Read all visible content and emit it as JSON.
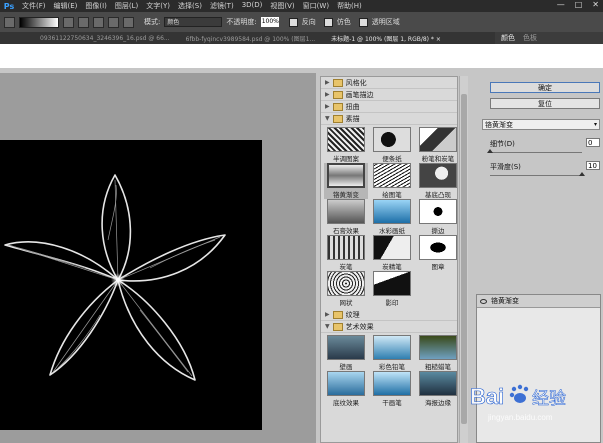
{
  "app": {
    "logo": "Ps"
  },
  "menu": [
    "文件(F)",
    "编辑(E)",
    "图像(I)",
    "图层(L)",
    "文字(Y)",
    "选择(S)",
    "滤镜(T)",
    "3D(D)",
    "视图(V)",
    "窗口(W)",
    "帮助(H)"
  ],
  "window_controls": [
    "—",
    "□",
    "✕"
  ],
  "options": {
    "mode_label": "模式:",
    "mode_value": "颜色",
    "opacity_label": "不透明度:",
    "opacity_value": "100%",
    "reverse_label": "反向",
    "dither_label": "仿色",
    "transparency_label": "透明区域"
  },
  "doc_tabs": [
    "09361122750634_3246396_16.psd @ 66...",
    "6fbb-fyqincv3989584.psd @ 100% (图层1...",
    "未标题-1 @ 100% (图层 1, RGB/8) * ×"
  ],
  "right_tabs": [
    "颜色",
    "色板"
  ],
  "filter_gallery": {
    "categories_top": [
      {
        "label": "风格化",
        "expanded": false
      },
      {
        "label": "画笔描边",
        "expanded": false
      },
      {
        "label": "扭曲",
        "expanded": false
      },
      {
        "label": "素描",
        "expanded": true
      }
    ],
    "sketch_filters": [
      {
        "label": "半调图案",
        "selected": false
      },
      {
        "label": "便条纸",
        "selected": false
      },
      {
        "label": "粉笔和炭笔",
        "selected": false
      },
      {
        "label": "铬黄渐变",
        "selected": true
      },
      {
        "label": "绘图笔",
        "selected": false
      },
      {
        "label": "基底凸现",
        "selected": false
      },
      {
        "label": "石膏效果",
        "selected": false
      },
      {
        "label": "水彩画纸",
        "selected": false
      },
      {
        "label": "撕边",
        "selected": false
      },
      {
        "label": "炭笔",
        "selected": false
      },
      {
        "label": "炭精笔",
        "selected": false
      },
      {
        "label": "图章",
        "selected": false
      },
      {
        "label": "网状",
        "selected": false
      },
      {
        "label": "影印",
        "selected": false
      }
    ],
    "categories_bottom": [
      {
        "label": "纹理",
        "expanded": false
      },
      {
        "label": "艺术效果",
        "expanded": true
      }
    ],
    "art_filters": [
      {
        "label": "壁画"
      },
      {
        "label": "彩色铅笔"
      },
      {
        "label": "粗糙蜡笔"
      },
      {
        "label": "底纹效果"
      },
      {
        "label": "干画笔"
      },
      {
        "label": "海报边缘"
      }
    ]
  },
  "controls": {
    "ok_label": "确定",
    "reset_label": "复位",
    "filter_select": "铬黄渐变",
    "detail_label": "细节(D)",
    "detail_value": "0",
    "smooth_label": "平滑度(S)",
    "smooth_value": "10",
    "detail_level": 0,
    "smooth_level": 1.0,
    "layer_name": "铬黄渐变"
  },
  "watermark": {
    "brand": "Bai",
    "brand2": "经验",
    "url": "jingyan.baidu.com"
  },
  "colors": {
    "accent": "#3aa0ff",
    "canvas": "#000000",
    "dialog_bg": "#c6c6c6"
  }
}
